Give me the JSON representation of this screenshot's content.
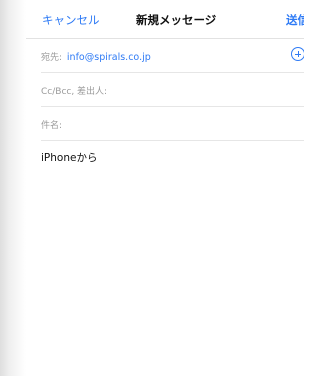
{
  "nav": {
    "cancel_label": "キャンセル",
    "title": "新規メッセージ",
    "send_label": "送信"
  },
  "fields": {
    "to_label": "宛先:",
    "to_value": "info@spirals.co.jp",
    "cc_bcc_label": "Cc/Bcc, 差出人:",
    "subject_label": "件名:",
    "add_icon": "plus-circle-icon"
  },
  "body": {
    "signature": "iPhoneから"
  },
  "colors": {
    "accent": "#2f7bf5",
    "label": "#9a9a9a",
    "separator": "#e6e6e6"
  }
}
